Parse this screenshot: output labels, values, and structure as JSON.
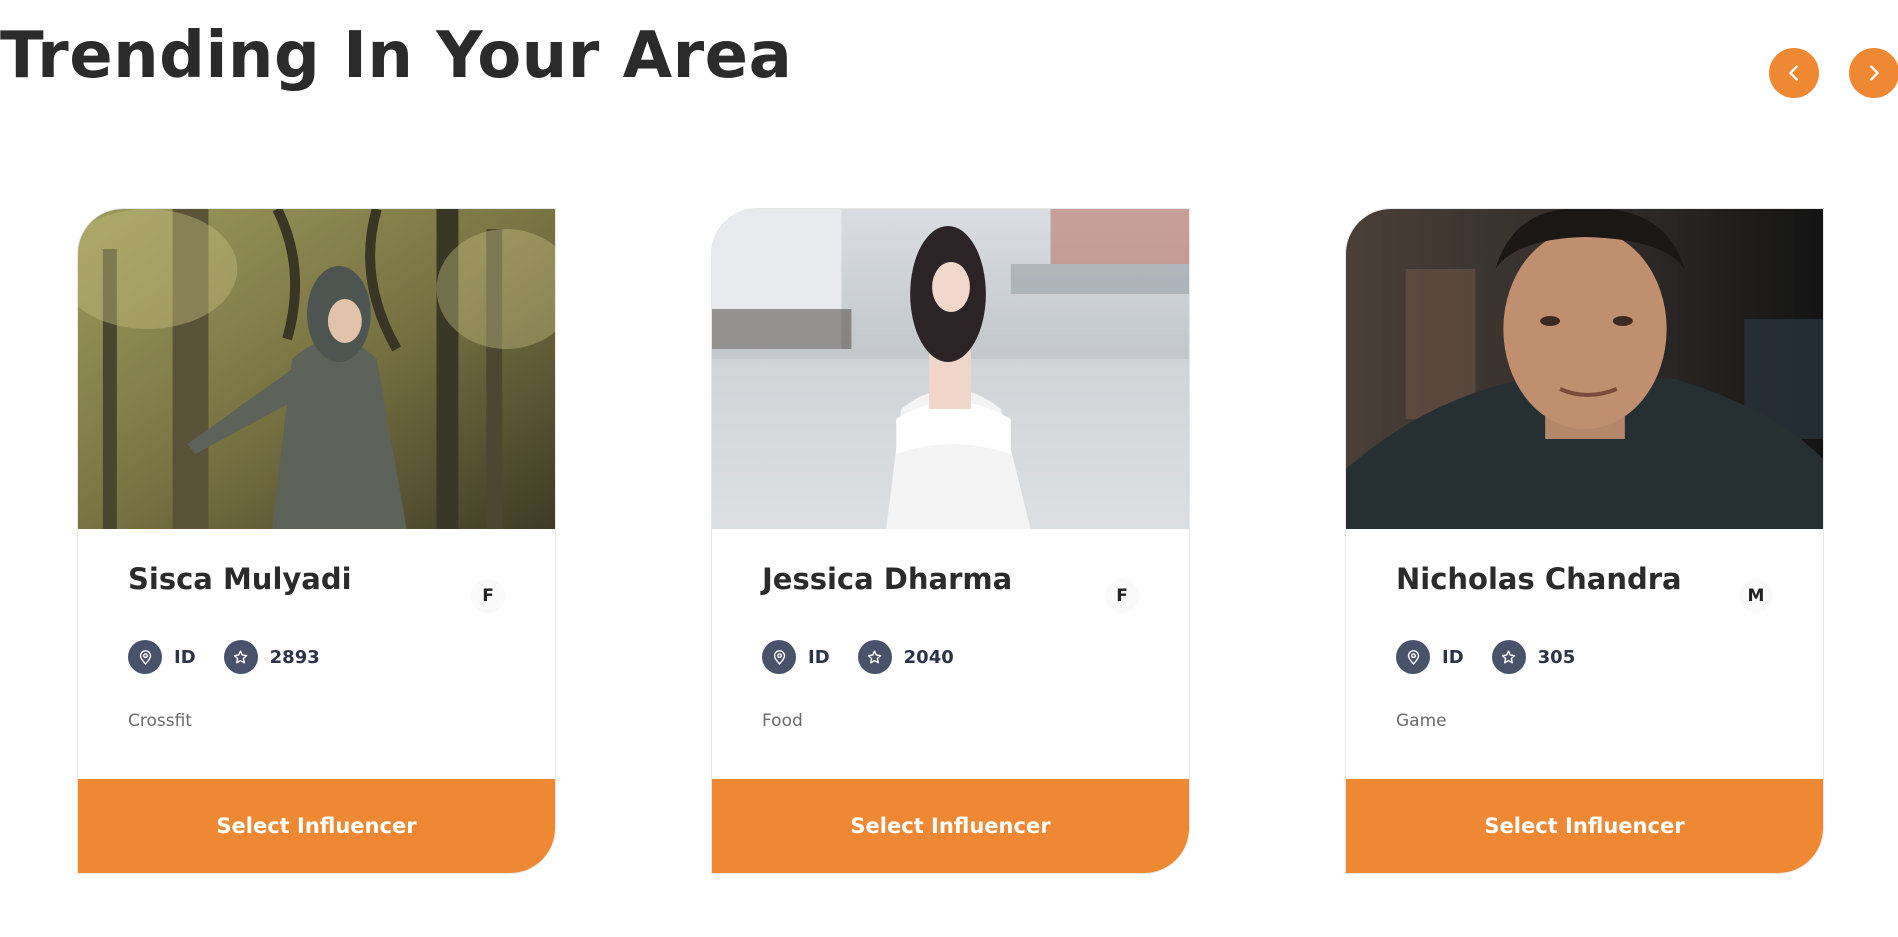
{
  "section": {
    "title": "Trending In Your Area"
  },
  "carousel": {
    "prev_icon": "chevron-left-icon",
    "next_icon": "chevron-right-icon"
  },
  "colors": {
    "accent": "#ee8833",
    "icon_bg": "#48526b",
    "heading": "#2b2b2b"
  },
  "influencers": [
    {
      "name": "Sisca Mulyadi",
      "gender": "F",
      "country": "ID",
      "rating": "2893",
      "category": "Crossfit",
      "button_label": "Select Influencer"
    },
    {
      "name": "Jessica Dharma",
      "gender": "F",
      "country": "ID",
      "rating": "2040",
      "category": "Food",
      "button_label": "Select Influencer"
    },
    {
      "name": "Nicholas Chandra",
      "gender": "M",
      "country": "ID",
      "rating": "305",
      "category": "Game",
      "button_label": "Select Influencer"
    }
  ],
  "icons": {
    "location": "map-pin-icon",
    "rating": "star-icon"
  }
}
